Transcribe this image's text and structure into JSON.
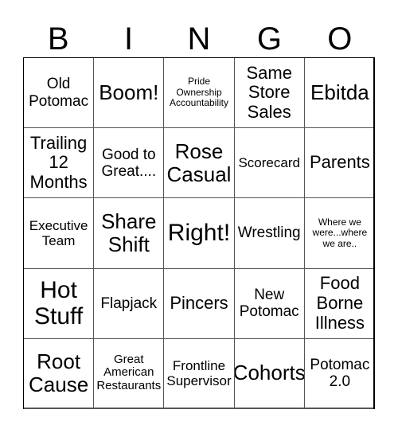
{
  "header": {
    "letters": [
      "B",
      "I",
      "N",
      "G",
      "O"
    ]
  },
  "cells": [
    [
      "Old\nPotomac",
      "Boom!",
      "Pride\nOwnership\nAccountability",
      "Same\nStore\nSales",
      "Ebitda"
    ],
    [
      "Trailing\n12\nMonths",
      "Good to\nGreat....",
      "Rose\nCasual",
      "Scorecard",
      "Parents"
    ],
    [
      "Executive\nTeam",
      "Share\nShift",
      "Right!",
      "Wrestling",
      "Where we\nwere...where\nwe are.."
    ],
    [
      "Hot\nStuff",
      "Flapjack",
      "Pincers",
      "New\nPotomac",
      "Food\nBorne\nIllness"
    ],
    [
      "Root\nCause",
      "Great\nAmerican\nRestaurants",
      "Frontline\nSupervisor",
      "Cohorts",
      "Potomac\n2.0"
    ]
  ]
}
